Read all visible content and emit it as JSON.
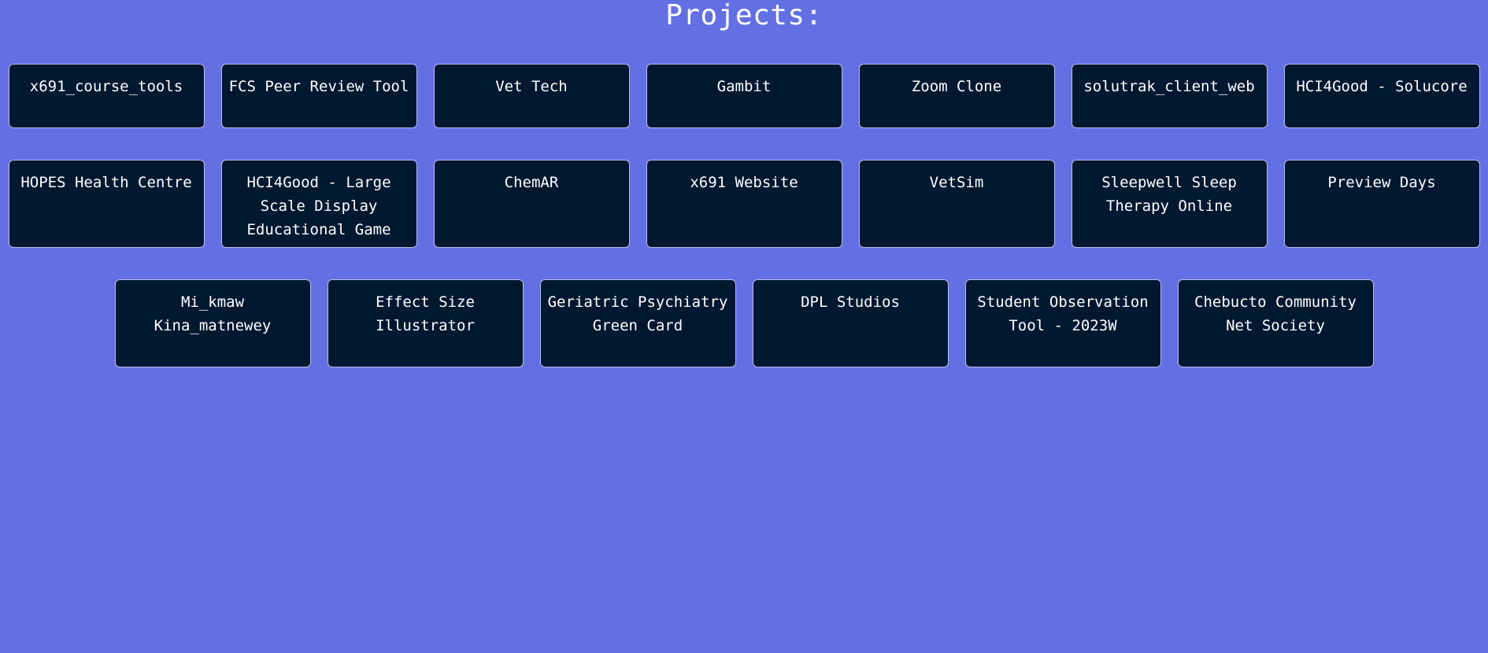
{
  "page": {
    "title": "Projects:",
    "background_color": "#6370e4",
    "card_color": "#001830",
    "card_border_color": "#b9bce9"
  },
  "projects": {
    "row1": [
      "x691_course_tools",
      "FCS Peer Review Tool",
      "Vet Tech",
      "Gambit",
      "Zoom Clone",
      "solutrak_client_web",
      "HCI4Good - Solucore"
    ],
    "row2": [
      "HOPES Health Centre",
      "HCI4Good - Large Scale Display Educational Game",
      "ChemAR",
      "x691 Website",
      "VetSim",
      "Sleepwell Sleep Therapy Online",
      "Preview Days"
    ],
    "row3": [
      "Mi_kmaw Kina_matnewey",
      "Effect Size Illustrator",
      "Geriatric Psychiatry Green Card",
      "DPL Studios",
      "Student Observation Tool - 2023W",
      "Chebucto Community Net Society"
    ]
  }
}
